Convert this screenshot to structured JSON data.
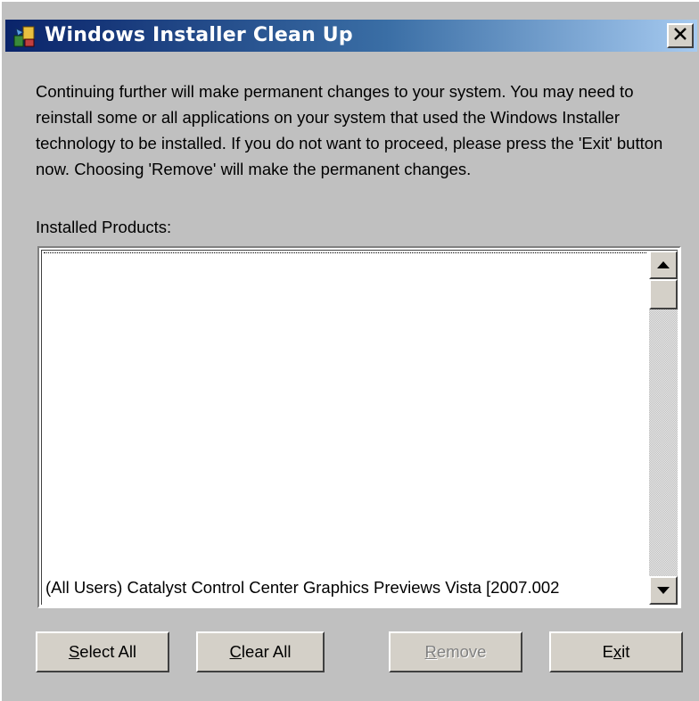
{
  "window": {
    "title": "Windows Installer Clean Up",
    "icon": "installer-cleanup-icon",
    "close_icon": "close-x-icon"
  },
  "message": "Continuing further will make permanent changes to your system. You may need to reinstall some or all applications on your system that used the Windows Installer technology to be installed. If you do not want to proceed, please press the 'Exit' button now. Choosing 'Remove' will make the permanent changes.",
  "installed_products": {
    "label": "Installed Products:",
    "visible_item": "(All Users) Catalyst Control Center Graphics Previews Vista [2007.002"
  },
  "buttons": {
    "select_all": {
      "accel": "S",
      "rest": "elect All",
      "enabled": true
    },
    "clear_all": {
      "accel": "C",
      "rest": "lear All",
      "enabled": true
    },
    "remove": {
      "accel": "R",
      "rest": "emove",
      "enabled": false
    },
    "exit": {
      "pre": "E",
      "accel": "x",
      "rest": "it",
      "enabled": true
    }
  },
  "colors": {
    "titlebar_start": "#0a246a",
    "titlebar_end": "#a6caf0",
    "dialog_background": "#c0c0c0"
  }
}
